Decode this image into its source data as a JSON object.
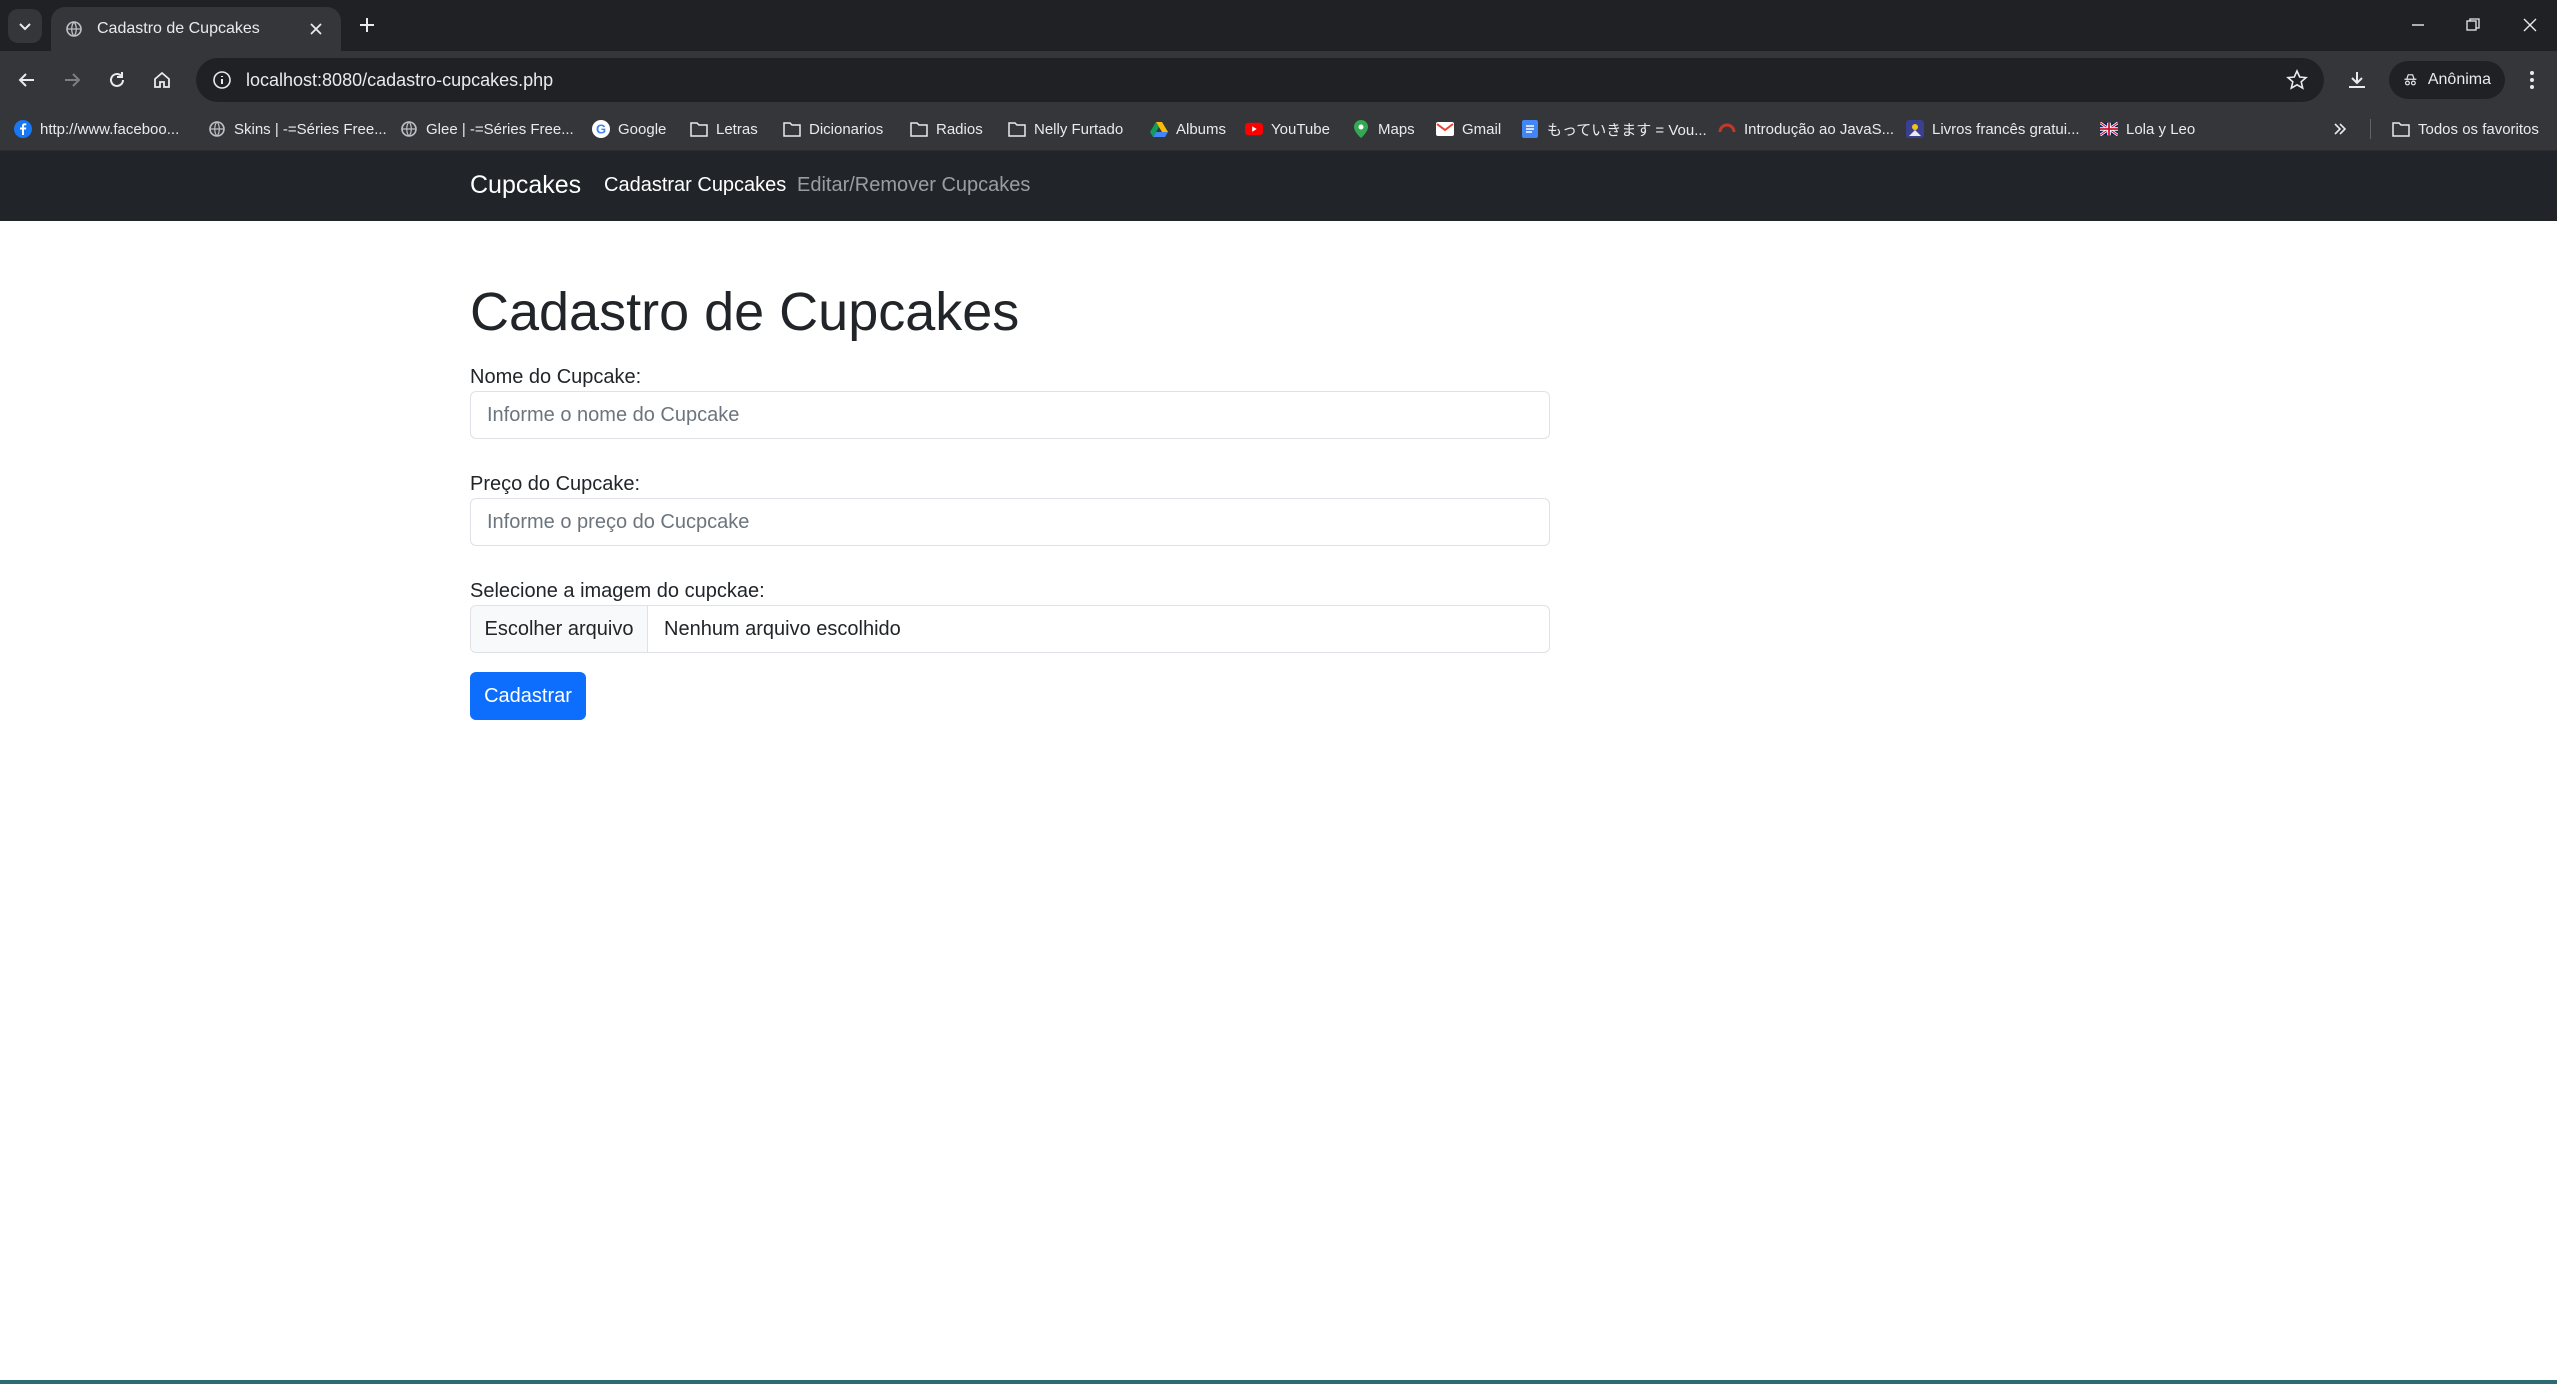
{
  "browser": {
    "tab": {
      "title": "Cadastro de Cupcakes"
    },
    "address": {
      "url": "localhost:8080/cadastro-cupcakes.php"
    },
    "profile": {
      "label": "Anônima"
    },
    "bookmarks": [
      {
        "label": "http://www.faceboo...",
        "icon": "facebook-icon"
      },
      {
        "label": "Skins | -=Séries Free...",
        "icon": "globe-icon"
      },
      {
        "label": "Glee | -=Séries Free...",
        "icon": "globe-icon"
      },
      {
        "label": "Google",
        "icon": "google-icon"
      },
      {
        "label": "Letras",
        "icon": "folder-icon"
      },
      {
        "label": "Dicionarios",
        "icon": "folder-icon"
      },
      {
        "label": "Radios",
        "icon": "folder-icon"
      },
      {
        "label": "Nelly Furtado",
        "icon": "folder-icon"
      },
      {
        "label": "Albums",
        "icon": "drive-icon"
      },
      {
        "label": "YouTube",
        "icon": "youtube-icon"
      },
      {
        "label": "Maps",
        "icon": "maps-icon"
      },
      {
        "label": "Gmail",
        "icon": "gmail-icon"
      },
      {
        "label": "もっていきます = Vou...",
        "icon": "docs-icon"
      },
      {
        "label": "Introdução ao JavaS...",
        "icon": "site-icon"
      },
      {
        "label": "Livros francês gratui...",
        "icon": "site-icon"
      },
      {
        "label": "Lola y Leo",
        "icon": "uk-flag-icon"
      }
    ],
    "all_bookmarks_label": "Todos os favoritos"
  },
  "navbar": {
    "brand": "Cupcakes",
    "links": [
      {
        "label": "Cadastrar Cupcakes",
        "active": true
      },
      {
        "label": "Editar/Remover Cupcakes",
        "active": false
      }
    ]
  },
  "form": {
    "title": "Cadastro de Cupcakes",
    "name_label": "Nome do Cupcake:",
    "name_placeholder": "Informe o nome do Cupcake",
    "price_label": "Preço do Cupcake:",
    "price_placeholder": "Informe o preço do Cucpcake",
    "image_label": "Selecione a imagem do cupckae:",
    "file_button": "Escolher arquivo",
    "file_status": "Nenhum arquivo escolhido",
    "submit_label": "Cadastrar"
  },
  "colors": {
    "navbar_bg": "#212529",
    "primary": "#0d6efd",
    "chrome_dark": "#202124",
    "chrome_toolbar": "#35363a"
  }
}
